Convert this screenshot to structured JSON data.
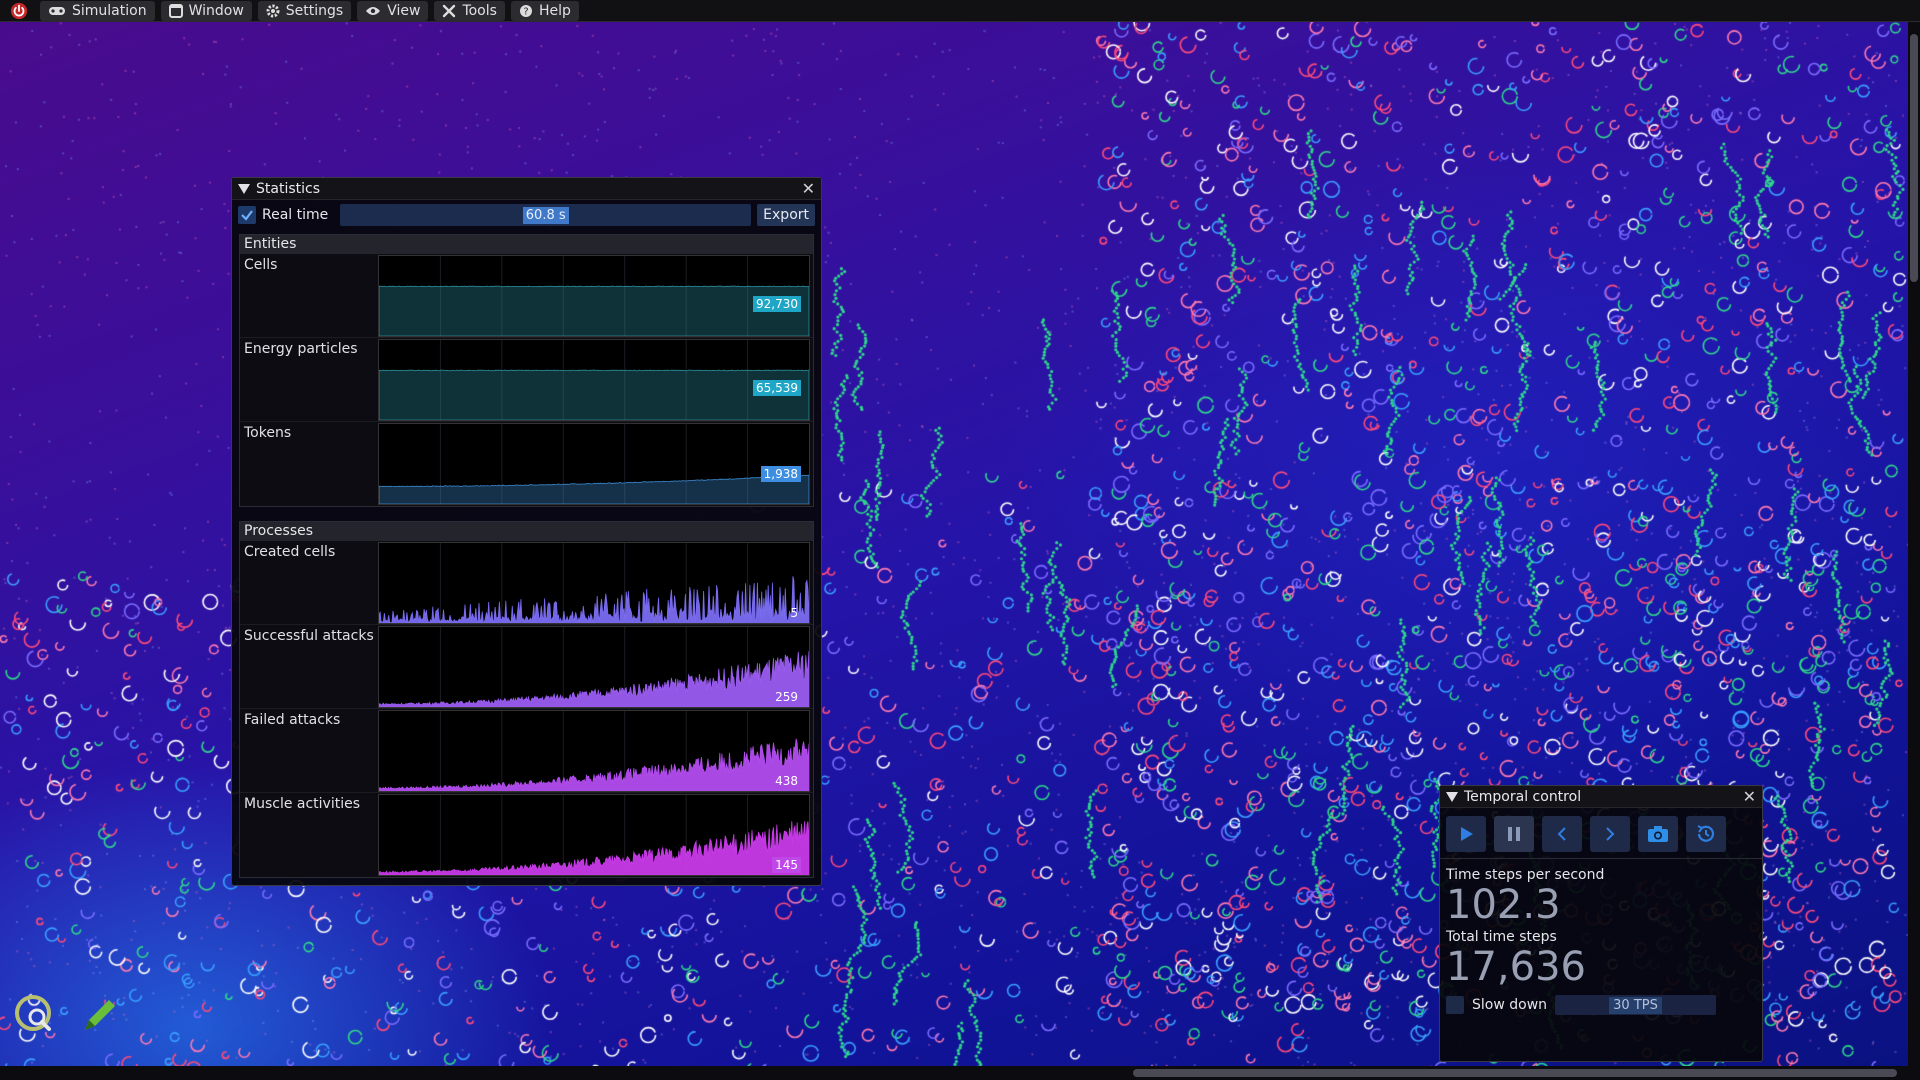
{
  "menubar": {
    "items": [
      {
        "label": "Simulation",
        "icon": "gamepad-icon"
      },
      {
        "label": "Window",
        "icon": "window-icon"
      },
      {
        "label": "Settings",
        "icon": "gear-icon"
      },
      {
        "label": "View",
        "icon": "eye-icon"
      },
      {
        "label": "Tools",
        "icon": "tools-icon"
      },
      {
        "label": "Help",
        "icon": "help-icon"
      }
    ],
    "power_icon": "power-icon"
  },
  "statistics": {
    "title": "Statistics",
    "realtime_label": "Real time",
    "realtime_checked": true,
    "time_window": "60.8 s",
    "export_label": "Export",
    "entities": {
      "header": "Entities",
      "plots": [
        {
          "label": "Cells",
          "value": "92,730",
          "kind": "flat",
          "level": 0.62,
          "color": "#2c8fa0",
          "badge": "#1fa6c6"
        },
        {
          "label": "Energy particles",
          "value": "65,539",
          "kind": "flat",
          "level": 0.62,
          "color": "#2c8fa0",
          "badge": "#1fa6c6"
        },
        {
          "label": "Tokens",
          "value": "1,938",
          "kind": "rise",
          "level": 0.35,
          "color": "#3b8ad0",
          "badge": "#3d8ee0"
        }
      ]
    },
    "processes": {
      "header": "Processes",
      "plots": [
        {
          "label": "Created cells",
          "value": "5",
          "kind": "noise",
          "color": "#7a6cf0",
          "badge": ""
        },
        {
          "label": "Successful attacks",
          "value": "259",
          "kind": "grow",
          "color": "#9a5cf0",
          "badge": ""
        },
        {
          "label": "Failed attacks",
          "value": "438",
          "kind": "grow",
          "color": "#b24cee",
          "badge": ""
        },
        {
          "label": "Muscle activities",
          "value": "145",
          "kind": "grow",
          "color": "#c83ae8",
          "badge": "#c048e8"
        }
      ]
    }
  },
  "temporal": {
    "title": "Temporal control",
    "buttons": [
      "play",
      "pause",
      "step-back",
      "step-forward",
      "snapshot",
      "restore"
    ],
    "tps_label": "Time steps per second",
    "tps_value": "102.3",
    "total_label": "Total time steps",
    "total_value": "17,636",
    "slowdown_label": "Slow down",
    "slowdown_value": "30 TPS"
  },
  "colors": {
    "accent": "#3f79c8",
    "panel_bg": "#06060a"
  }
}
